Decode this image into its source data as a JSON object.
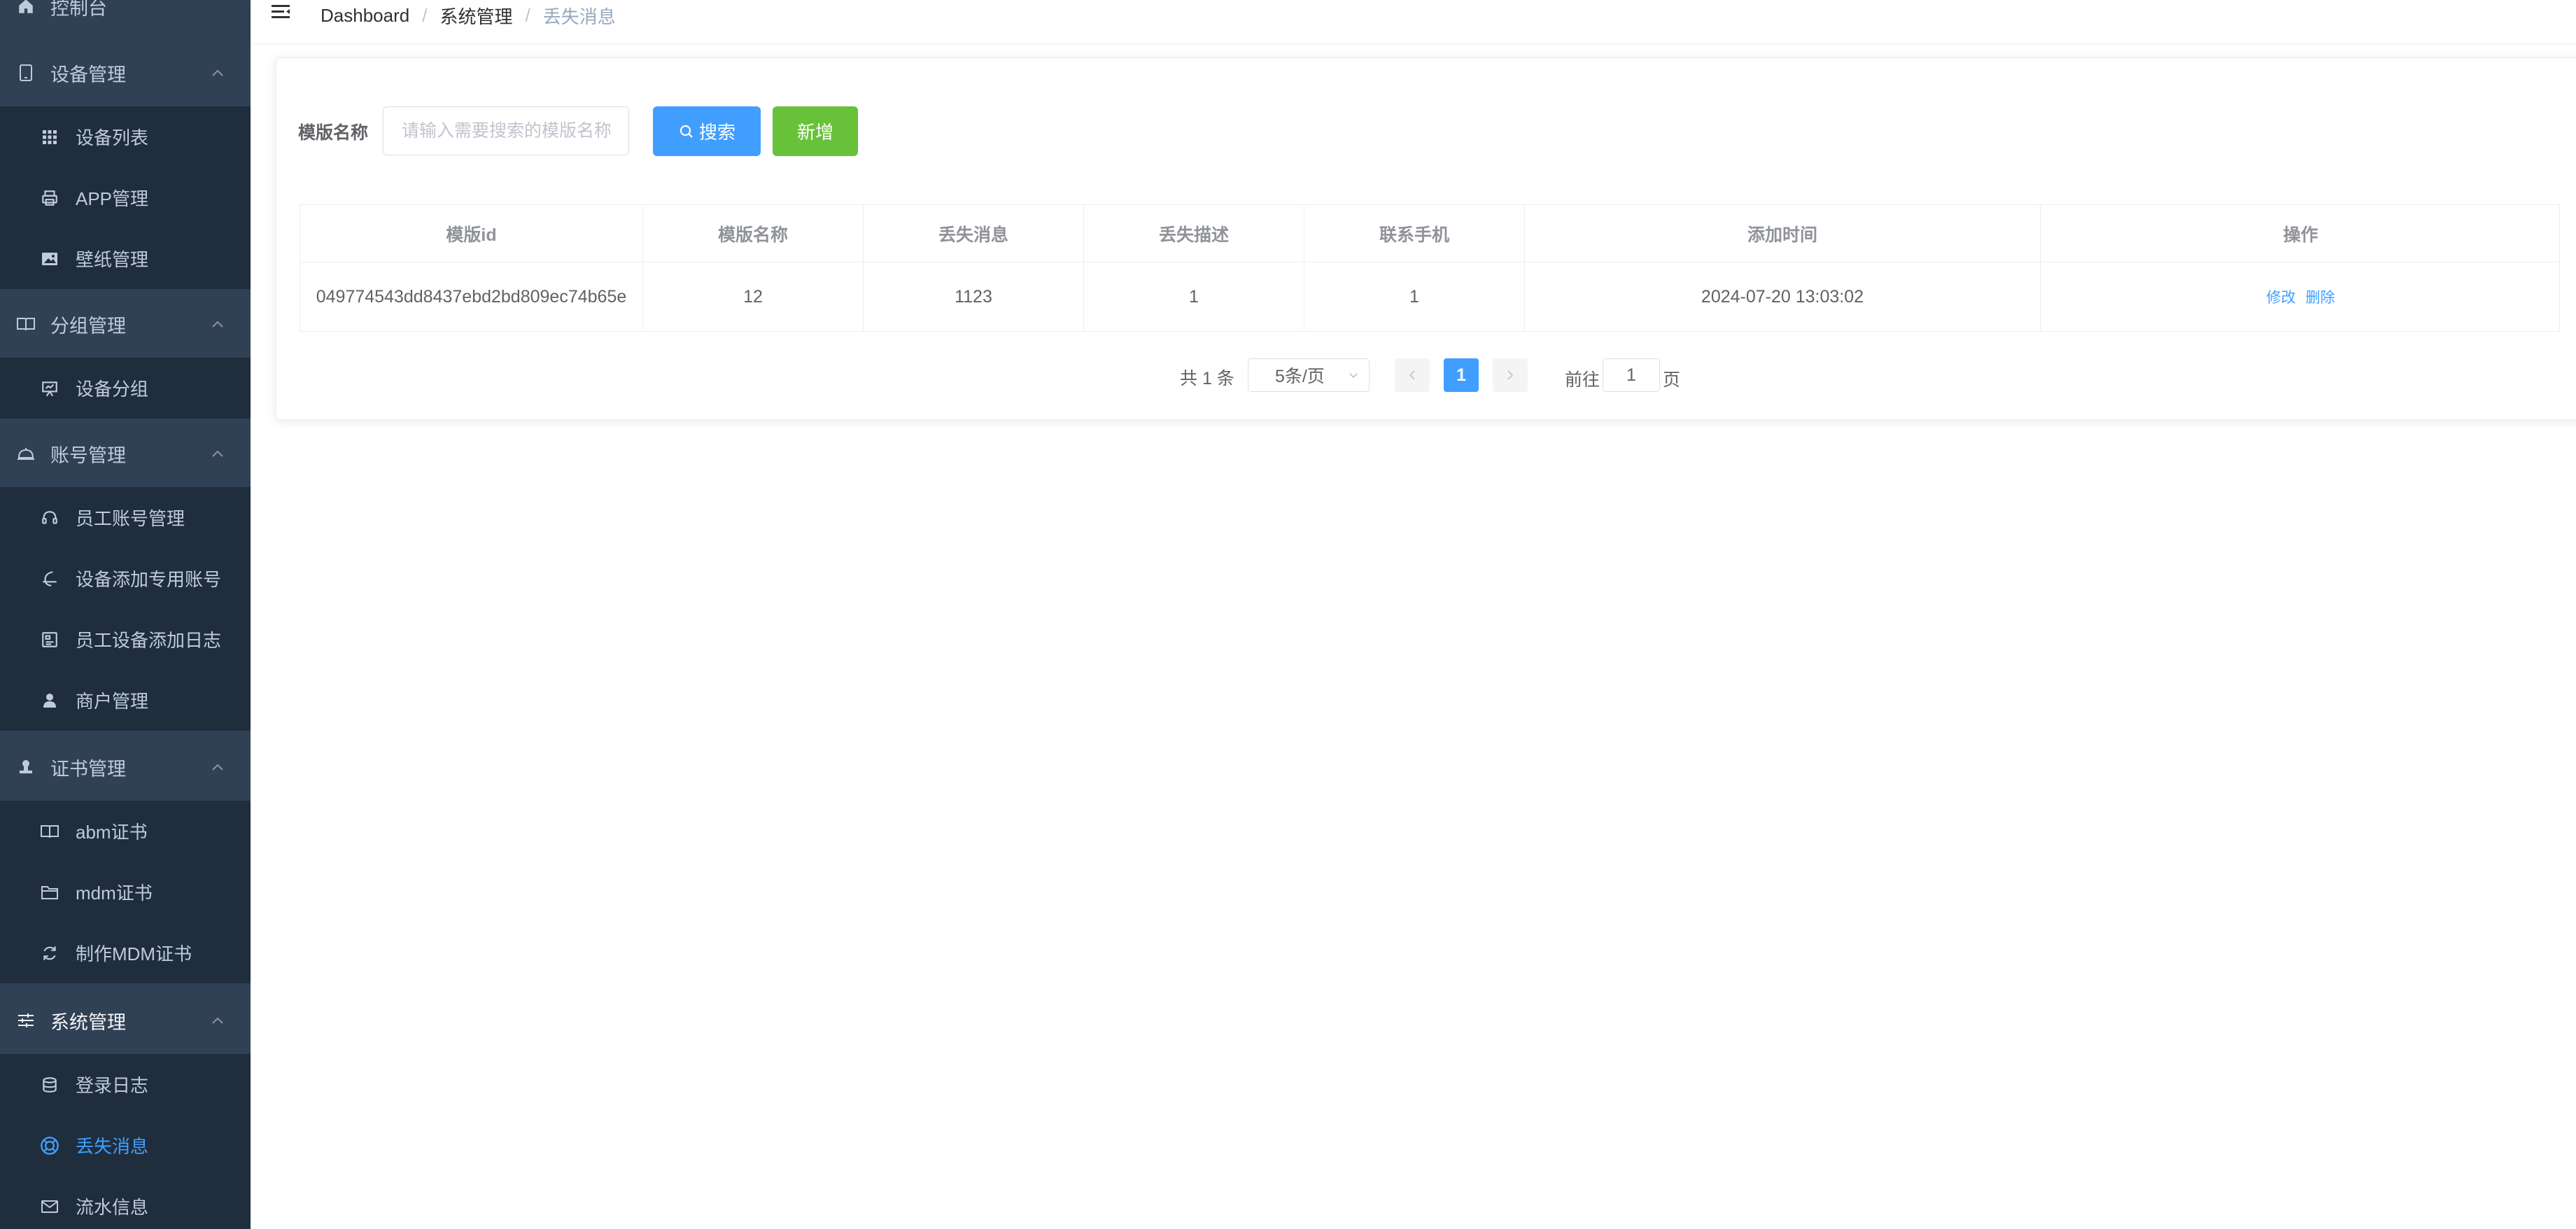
{
  "sidebar": {
    "top_item": {
      "label": "控制台",
      "icon": "home-icon"
    },
    "groups": [
      {
        "label": "设备管理",
        "icon": "tablet-icon",
        "items": [
          {
            "label": "设备列表",
            "icon": "grid-icon"
          },
          {
            "label": "APP管理",
            "icon": "printer-icon"
          },
          {
            "label": "壁纸管理",
            "icon": "picture-icon"
          }
        ]
      },
      {
        "label": "分组管理",
        "icon": "notebook-icon",
        "items": [
          {
            "label": "设备分组",
            "icon": "presentation-icon"
          }
        ]
      },
      {
        "label": "账号管理",
        "icon": "cloche-icon",
        "items": [
          {
            "label": "员工账号管理",
            "icon": "headset-icon"
          },
          {
            "label": "设备添加专用账号",
            "icon": "moon-icon"
          },
          {
            "label": "员工设备添加日志",
            "icon": "document-icon"
          },
          {
            "label": "商户管理",
            "icon": "user-icon"
          }
        ]
      },
      {
        "label": "证书管理",
        "icon": "stamp-icon",
        "items": [
          {
            "label": "abm证书",
            "icon": "book-icon"
          },
          {
            "label": "mdm证书",
            "icon": "folder-icon"
          },
          {
            "label": "制作MDM证书",
            "icon": "refresh-icon"
          }
        ]
      },
      {
        "label": "系统管理",
        "icon": "sliders-icon",
        "items": [
          {
            "label": "登录日志",
            "icon": "coins-icon"
          },
          {
            "label": "丢失消息",
            "icon": "lifebuoy-icon",
            "active": true
          },
          {
            "label": "流水信息",
            "icon": "message-icon"
          }
        ]
      }
    ]
  },
  "header": {
    "breadcrumb": [
      "Dashboard",
      "系统管理",
      "丢失消息"
    ]
  },
  "search": {
    "label": "模版名称",
    "placeholder": "请输入需要搜索的模版名称",
    "value": "",
    "search_button": "搜索",
    "add_button": "新增"
  },
  "table": {
    "columns": [
      "模版id",
      "模版名称",
      "丢失消息",
      "丢失描述",
      "联系手机",
      "添加时间",
      "操作"
    ],
    "rows": [
      [
        "049774543dd8437ebd2bd809ec74b65e",
        "12",
        "1123",
        "1",
        "1",
        "2024-07-20 13:03:02"
      ]
    ],
    "actions": [
      "修改",
      "删除"
    ]
  },
  "pagination": {
    "total_text": "共 1 条",
    "page_size": "5条/页",
    "current_page": "1",
    "goto_label": "前往",
    "goto_value": "1",
    "goto_unit": "页"
  },
  "colors": {
    "sidebar_bg": "#304156",
    "submenu_bg": "#1f2d3d",
    "primary": "#409eff",
    "success": "#67c23a"
  }
}
